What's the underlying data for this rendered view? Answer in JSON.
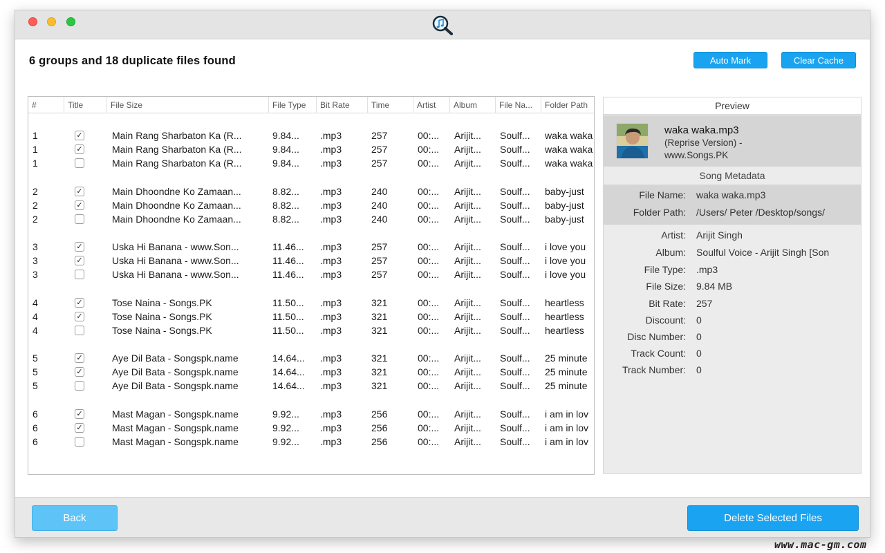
{
  "window": {
    "app_icon": "music-search-icon"
  },
  "header": {
    "title": "6 groups and 18 duplicate files found",
    "auto_mark": "Auto Mark",
    "clear_cache": "Clear Cache"
  },
  "table": {
    "columns": [
      "#",
      "Title",
      "File Size",
      "File Type",
      "Bit Rate",
      "Time",
      "Artist",
      "Album",
      "File Na...",
      "Folder Path"
    ],
    "groups": [
      {
        "rows": [
          {
            "num": "1",
            "checked": true,
            "file": "Main Rang Sharbaton Ka (R...",
            "size": "9.84...",
            "type": ".mp3",
            "bitrate": "257",
            "time": "00:...",
            "artist": "Arijit...",
            "album": "Soulf...",
            "folder": "waka waka"
          },
          {
            "num": "1",
            "checked": true,
            "file": "Main Rang Sharbaton Ka (R...",
            "size": "9.84...",
            "type": ".mp3",
            "bitrate": "257",
            "time": "00:...",
            "artist": "Arijit...",
            "album": "Soulf...",
            "folder": "waka waka"
          },
          {
            "num": "1",
            "checked": false,
            "file": "Main Rang Sharbaton Ka (R...",
            "size": "9.84...",
            "type": ".mp3",
            "bitrate": "257",
            "time": "00:...",
            "artist": "Arijit...",
            "album": "Soulf...",
            "folder": "waka waka"
          }
        ]
      },
      {
        "rows": [
          {
            "num": "2",
            "checked": true,
            "file": "Main Dhoondne Ko Zamaan...",
            "size": "8.82...",
            "type": ".mp3",
            "bitrate": "240",
            "time": "00:...",
            "artist": "Arijit...",
            "album": "Soulf...",
            "folder": "baby-just"
          },
          {
            "num": "2",
            "checked": true,
            "file": "Main Dhoondne Ko Zamaan...",
            "size": "8.82...",
            "type": ".mp3",
            "bitrate": "240",
            "time": "00:...",
            "artist": "Arijit...",
            "album": "Soulf...",
            "folder": "baby-just"
          },
          {
            "num": "2",
            "checked": false,
            "file": "Main Dhoondne Ko Zamaan...",
            "size": "8.82...",
            "type": ".mp3",
            "bitrate": "240",
            "time": "00:...",
            "artist": "Arijit...",
            "album": "Soulf...",
            "folder": "baby-just"
          }
        ]
      },
      {
        "rows": [
          {
            "num": "3",
            "checked": true,
            "file": "Uska Hi Banana - www.Son...",
            "size": "11.46...",
            "type": ".mp3",
            "bitrate": "257",
            "time": "00:...",
            "artist": "Arijit...",
            "album": "Soulf...",
            "folder": "i love you"
          },
          {
            "num": "3",
            "checked": true,
            "file": "Uska Hi Banana - www.Son...",
            "size": "11.46...",
            "type": ".mp3",
            "bitrate": "257",
            "time": "00:...",
            "artist": "Arijit...",
            "album": "Soulf...",
            "folder": "i love you"
          },
          {
            "num": "3",
            "checked": false,
            "file": "Uska Hi Banana - www.Son...",
            "size": "11.46...",
            "type": ".mp3",
            "bitrate": "257",
            "time": "00:...",
            "artist": "Arijit...",
            "album": "Soulf...",
            "folder": "i love you"
          }
        ]
      },
      {
        "rows": [
          {
            "num": "4",
            "checked": true,
            "file": "Tose Naina - Songs.PK",
            "size": "11.50...",
            "type": ".mp3",
            "bitrate": "321",
            "time": "00:...",
            "artist": "Arijit...",
            "album": "Soulf...",
            "folder": "heartless"
          },
          {
            "num": "4",
            "checked": true,
            "file": "Tose Naina - Songs.PK",
            "size": "11.50...",
            "type": ".mp3",
            "bitrate": "321",
            "time": "00:...",
            "artist": "Arijit...",
            "album": "Soulf...",
            "folder": "heartless"
          },
          {
            "num": "4",
            "checked": false,
            "file": "Tose Naina - Songs.PK",
            "size": "11.50...",
            "type": ".mp3",
            "bitrate": "321",
            "time": "00:...",
            "artist": "Arijit...",
            "album": "Soulf...",
            "folder": "heartless"
          }
        ]
      },
      {
        "rows": [
          {
            "num": "5",
            "checked": true,
            "file": "Aye Dil Bata - Songspk.name",
            "size": "14.64...",
            "type": ".mp3",
            "bitrate": "321",
            "time": "00:...",
            "artist": "Arijit...",
            "album": "Soulf...",
            "folder": "25 minute"
          },
          {
            "num": "5",
            "checked": true,
            "file": "Aye Dil Bata - Songspk.name",
            "size": "14.64...",
            "type": ".mp3",
            "bitrate": "321",
            "time": "00:...",
            "artist": "Arijit...",
            "album": "Soulf...",
            "folder": "25 minute"
          },
          {
            "num": "5",
            "checked": false,
            "file": "Aye Dil Bata - Songspk.name",
            "size": "14.64...",
            "type": ".mp3",
            "bitrate": "321",
            "time": "00:...",
            "artist": "Arijit...",
            "album": "Soulf...",
            "folder": "25 minute"
          }
        ]
      },
      {
        "rows": [
          {
            "num": "6",
            "checked": true,
            "file": "Mast Magan - Songspk.name",
            "size": "9.92...",
            "type": ".mp3",
            "bitrate": "256",
            "time": "00:...",
            "artist": "Arijit...",
            "album": "Soulf...",
            "folder": "i am in lov"
          },
          {
            "num": "6",
            "checked": true,
            "file": "Mast Magan - Songspk.name",
            "size": "9.92...",
            "type": ".mp3",
            "bitrate": "256",
            "time": "00:...",
            "artist": "Arijit...",
            "album": "Soulf...",
            "folder": "i am in lov"
          },
          {
            "num": "6",
            "checked": false,
            "file": "Mast Magan - Songspk.name",
            "size": "9.92...",
            "type": ".mp3",
            "bitrate": "256",
            "time": "00:...",
            "artist": "Arijit...",
            "album": "Soulf...",
            "folder": "i am in lov"
          }
        ]
      }
    ]
  },
  "preview": {
    "header": "Preview",
    "filename": "waka waka.mp3",
    "subtitle_line1": "(Reprise Version) -",
    "subtitle_line2": "www.Songs.PK",
    "metadata_header": "Song Metadata",
    "fields": [
      {
        "label": "File Name:",
        "value": "waka waka.mp3"
      },
      {
        "label": "Folder Path:",
        "value": "/Users/  Peter   /Desktop/songs/"
      },
      {
        "label": "Artist:",
        "value": "Arijit Singh"
      },
      {
        "label": "Album:",
        "value": "Soulful Voice - Arijit Singh [Son"
      },
      {
        "label": "File Type:",
        "value": ".mp3"
      },
      {
        "label": "File Size:",
        "value": "9.84 MB"
      },
      {
        "label": "Bit Rate:",
        "value": "257"
      },
      {
        "label": "Discount:",
        "value": "0"
      },
      {
        "label": "Disc Number:",
        "value": "0"
      },
      {
        "label": "Track Count:",
        "value": "0"
      },
      {
        "label": "Track Number:",
        "value": "0"
      }
    ]
  },
  "footer": {
    "back": "Back",
    "delete": "Delete Selected Files"
  },
  "watermark": "www.mac-gm.com",
  "colors": {
    "accent": "#1aa3f0",
    "back_button": "#5ec3f6"
  }
}
